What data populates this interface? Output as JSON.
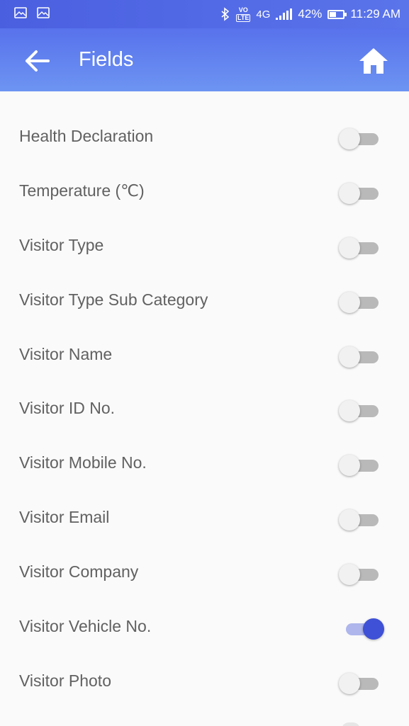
{
  "status_bar": {
    "bluetooth_icon": "bluetooth-icon",
    "volte_top": "VO",
    "volte_bottom": "LTE",
    "network": "4G",
    "battery": "42%",
    "time": "11:29 AM"
  },
  "app_bar": {
    "title": "Fields",
    "back_icon": "arrow-left-icon",
    "home_icon": "home-icon"
  },
  "colors": {
    "accent": "#3f51d6",
    "header": "#5872ec",
    "label": "#616161"
  },
  "fields": [
    {
      "label": "Health Declaration",
      "enabled": false
    },
    {
      "label": "Temperature  (℃)",
      "enabled": false
    },
    {
      "label": "Visitor Type",
      "enabled": false
    },
    {
      "label": "Visitor Type Sub Category",
      "enabled": false
    },
    {
      "label": "Visitor Name",
      "enabled": false
    },
    {
      "label": "Visitor ID No.",
      "enabled": false
    },
    {
      "label": "Visitor Mobile No.",
      "enabled": false
    },
    {
      "label": "Visitor Email",
      "enabled": false
    },
    {
      "label": "Visitor Company",
      "enabled": false
    },
    {
      "label": "Visitor Vehicle No.",
      "enabled": true
    },
    {
      "label": "Visitor Photo",
      "enabled": false
    }
  ]
}
